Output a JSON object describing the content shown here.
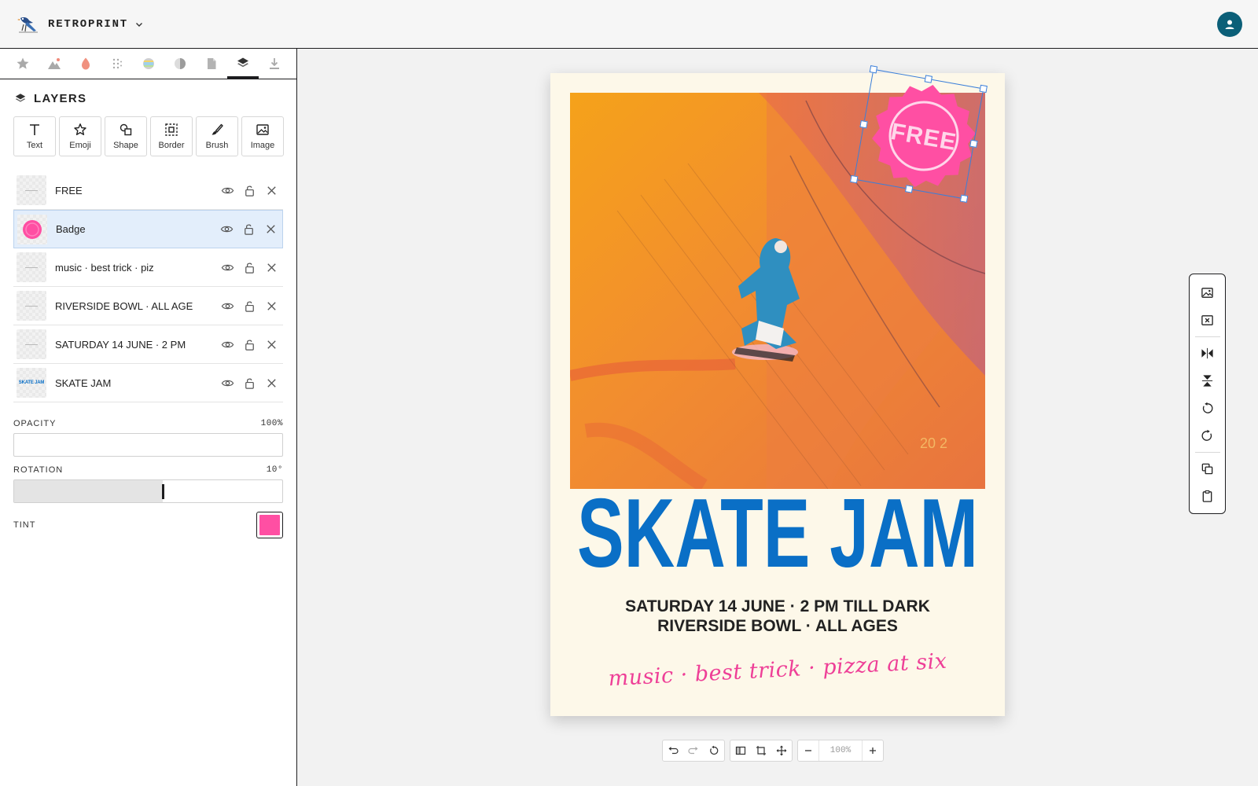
{
  "app": {
    "name": "RETROPRINT",
    "accent": "#0b5f78"
  },
  "tool_tabs": [
    {
      "icon": "star-icon"
    },
    {
      "icon": "mountain-icon"
    },
    {
      "icon": "flame-icon"
    },
    {
      "icon": "dots-grid-icon"
    },
    {
      "icon": "palette-icon"
    },
    {
      "icon": "half-circle-icon"
    },
    {
      "icon": "page-icon"
    },
    {
      "icon": "layers-icon",
      "active": true
    },
    {
      "icon": "download-icon"
    }
  ],
  "layers_panel": {
    "title": "LAYERS",
    "add_buttons": [
      {
        "label": "Text",
        "icon": "text-icon"
      },
      {
        "label": "Emoji",
        "icon": "star-icon"
      },
      {
        "label": "Shape",
        "icon": "shape-icon"
      },
      {
        "label": "Border",
        "icon": "border-icon"
      },
      {
        "label": "Brush",
        "icon": "brush-icon"
      },
      {
        "label": "Image",
        "icon": "image-icon"
      }
    ],
    "layers": [
      {
        "name": "FREE",
        "selected": false
      },
      {
        "name": "Badge",
        "selected": true
      },
      {
        "name": "music · best trick · piz",
        "selected": false
      },
      {
        "name": "RIVERSIDE BOWL · ALL AGE",
        "selected": false
      },
      {
        "name": "SATURDAY 14 JUNE · 2 PM",
        "selected": false
      },
      {
        "name": "SKATE JAM",
        "selected": false,
        "thumb_text": "SKATE JAM"
      }
    ]
  },
  "properties": {
    "opacity": {
      "label": "OPACITY",
      "value_text": "100%",
      "value": 100
    },
    "rotation": {
      "label": "ROTATION",
      "value_text": "10°",
      "value": 10,
      "min": -90,
      "max": 90
    },
    "tint": {
      "label": "TINT",
      "color": "#ff4fa3"
    }
  },
  "poster": {
    "title": "SKATE JAM",
    "title_color": "#0a6fc6",
    "line1": "SATURDAY 14 JUNE · 2 PM TILL DARK",
    "line2": "RIVERSIDE BOWL · ALL AGES",
    "tagline": "music · best trick · pizza at six",
    "badge_text": "FREE",
    "badge_color": "#ff4fa3",
    "photo_stamp": "20   2"
  },
  "float_toolbar": [
    "image-icon",
    "remove-image-icon",
    "flip-horizontal-icon",
    "flip-vertical-icon",
    "rotate-left-icon",
    "rotate-right-icon",
    "duplicate-icon",
    "paste-icon"
  ],
  "bottom_toolbar": {
    "zoom": "100%"
  }
}
